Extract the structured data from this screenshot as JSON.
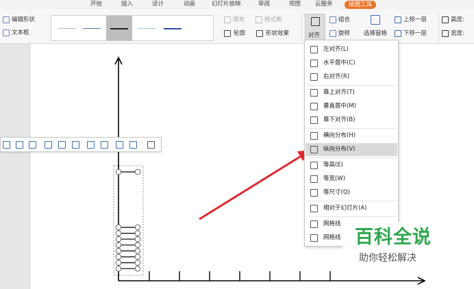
{
  "menu": {
    "tabs": [
      {
        "label": "开始"
      },
      {
        "label": "插入"
      },
      {
        "label": "设计"
      },
      {
        "label": "动画"
      },
      {
        "label": "幻灯片放映"
      },
      {
        "label": "审阅"
      },
      {
        "label": "视图"
      },
      {
        "label": "云服务"
      },
      {
        "label": "绘图工具",
        "active": true
      }
    ]
  },
  "ribbon": {
    "edit_shape": "编辑形状",
    "text_box": "文本框",
    "fill": "填充",
    "format_painter": "格式刷",
    "outline": "轮廓",
    "shape_effects": "形状效果",
    "align": "对齐",
    "group": "组合",
    "rotate": "旋转",
    "selection_pane": "选择窗格",
    "bring_forward": "上移一层",
    "send_backward": "下移一层",
    "height_label": "高度:",
    "width_label": "宽度:"
  },
  "align_menu": {
    "items": [
      {
        "label": "左对齐(L)",
        "icon": "align-left-icon"
      },
      {
        "label": "水平居中(C)",
        "icon": "align-center-icon"
      },
      {
        "label": "右对齐(R)",
        "icon": "align-right-icon"
      },
      {
        "label": "靠上对齐(T)",
        "icon": "align-top-icon"
      },
      {
        "label": "垂直居中(M)",
        "icon": "align-middle-icon"
      },
      {
        "label": "靠下对齐(B)",
        "icon": "align-bottom-icon"
      },
      {
        "label": "横向分布(H)",
        "icon": "distribute-horizontal-icon"
      },
      {
        "label": "纵向分布(V)",
        "icon": "distribute-vertical-icon",
        "highlighted": true
      },
      {
        "label": "等高(E)",
        "icon": "same-height-icon"
      },
      {
        "label": "等宽(W)",
        "icon": "same-width-icon"
      },
      {
        "label": "等尺寸(Q)",
        "icon": "same-size-icon"
      },
      {
        "label": "相对于幻灯片(A)",
        "icon": "relative-to-slide-icon"
      },
      {
        "label": "网格线",
        "icon": "gridlines-icon"
      },
      {
        "label": "网格线",
        "icon": "grid-settings-icon"
      }
    ]
  },
  "floating_toolbar": {
    "icons": [
      "align-left-icon",
      "align-center-icon",
      "align-right-icon",
      "align-top-icon",
      "align-middle-icon",
      "align-bottom-icon",
      "distribute-horizontal-icon",
      "distribute-horizontal-icon",
      "distribute-vertical-icon",
      "align-options-icon",
      "group-icon"
    ]
  },
  "watermark": {
    "title": "百科全说",
    "subtitle": "助你轻松解决"
  },
  "colors": {
    "accent_tab": "#e9742a",
    "arrow": "#e0282e",
    "watermark_green": "#2fa84f",
    "icon_blue": "#3b6bb0"
  }
}
